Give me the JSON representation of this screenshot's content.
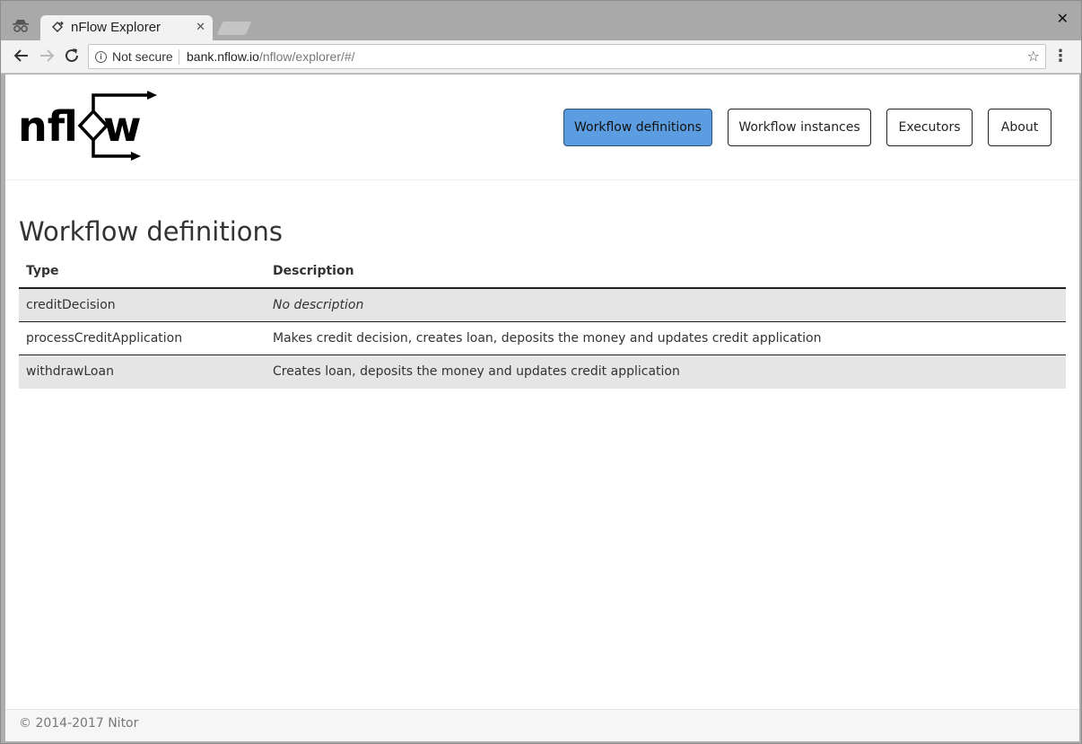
{
  "browser": {
    "tab_title": "nFlow Explorer",
    "security_label": "Not secure",
    "url_host": "bank.nflow.io",
    "url_path": "/nflow/explorer/#/"
  },
  "header": {
    "logo_text": "nflow",
    "nav": [
      {
        "label": "Workflow definitions",
        "active": true
      },
      {
        "label": "Workflow instances",
        "active": false
      },
      {
        "label": "Executors",
        "active": false
      },
      {
        "label": "About",
        "active": false
      }
    ]
  },
  "main": {
    "title": "Workflow definitions",
    "columns": [
      "Type",
      "Description"
    ],
    "rows": [
      {
        "type": "creditDecision",
        "description": "No description"
      },
      {
        "type": "processCreditApplication",
        "description": "Makes credit decision, creates loan, deposits the money and updates credit application"
      },
      {
        "type": "withdrawLoan",
        "description": "Creates loan, deposits the money and updates credit application"
      }
    ]
  },
  "footer": {
    "copyright": "© 2014-2017 Nitor"
  },
  "colors": {
    "active_nav": "#5b9de0",
    "row_shade": "#e5e5e5"
  },
  "icons": [
    "incognito-icon",
    "tab-favicon-icon",
    "tab-close-icon",
    "window-close-icon",
    "back-icon",
    "forward-icon",
    "reload-icon",
    "info-icon",
    "bookmark-star-icon",
    "menu-dots-icon"
  ]
}
